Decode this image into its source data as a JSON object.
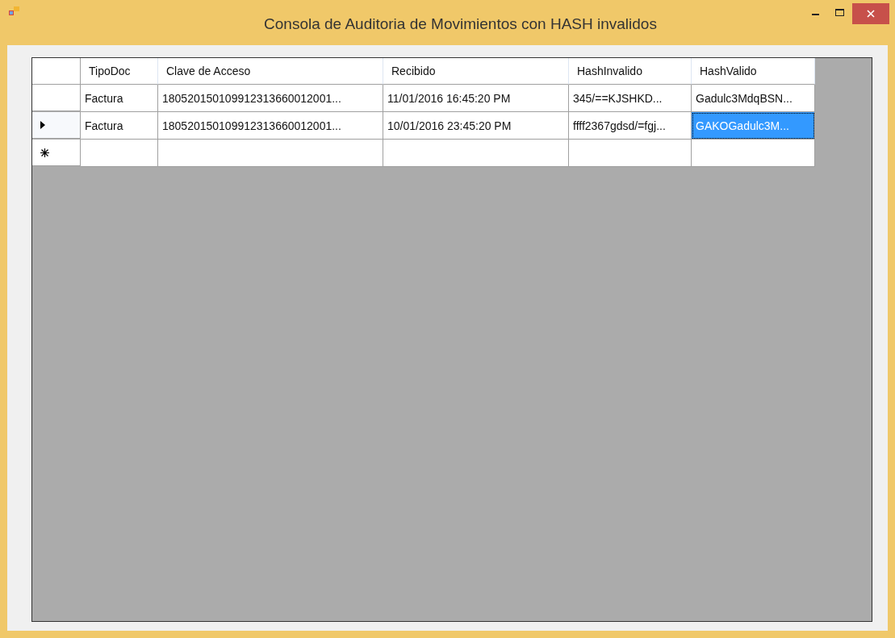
{
  "window": {
    "title": "Consola de Auditoria de Movimientos con HASH invalidos"
  },
  "table": {
    "columns": [
      "TipoDoc",
      "Clave de Acceso",
      "Recibido",
      "HashInvalido",
      "HashValido"
    ],
    "rows": [
      {
        "kind": "data",
        "current": false,
        "cells": [
          {
            "text": "Factura",
            "selected": false
          },
          {
            "text": "180520150109912313660012001...",
            "selected": false
          },
          {
            "text": "11/01/2016 16:45:20 PM",
            "selected": false
          },
          {
            "text": "345/==KJSHKD...",
            "selected": false
          },
          {
            "text": "Gadulc3MdqBSN...",
            "selected": false
          }
        ]
      },
      {
        "kind": "data",
        "current": true,
        "cells": [
          {
            "text": "Factura",
            "selected": false
          },
          {
            "text": "180520150109912313660012001...",
            "selected": false
          },
          {
            "text": "10/01/2016 23:45:20 PM",
            "selected": false
          },
          {
            "text": "ffff2367gdsd/=fgj...",
            "selected": false
          },
          {
            "text": "GAKOGadulc3M...",
            "selected": true
          }
        ]
      },
      {
        "kind": "new"
      }
    ]
  }
}
